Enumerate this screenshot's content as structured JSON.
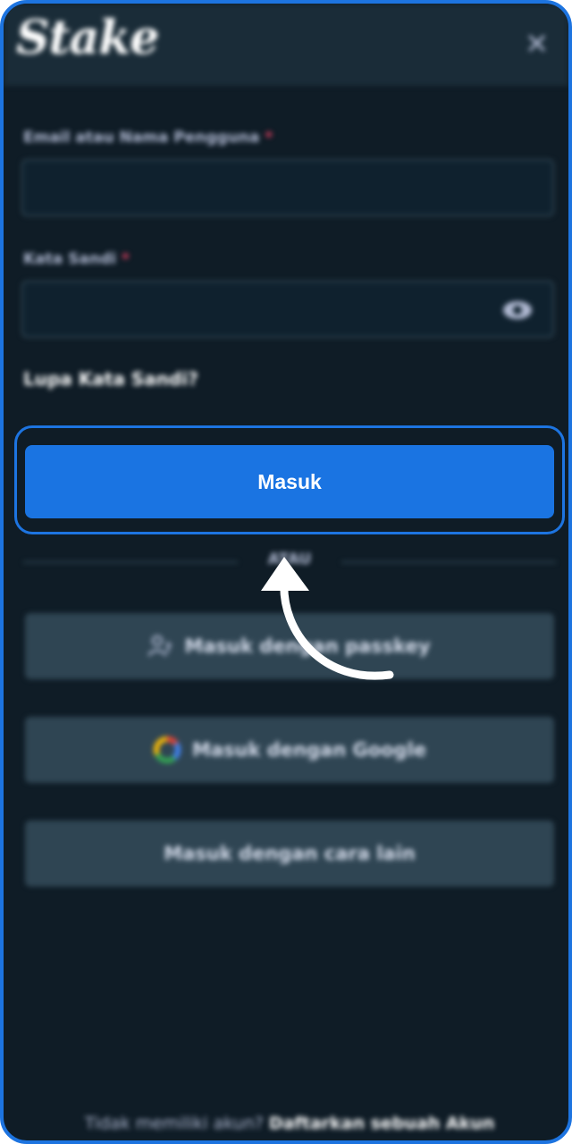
{
  "app": {
    "logo_text": "Stake"
  },
  "form": {
    "email_label": "Email atau Nama Pengguna",
    "password_label": "Kata Sandi",
    "required_mark": "*",
    "forgot_password": "Lupa Kata Sandi?",
    "submit_label": "Masuk",
    "divider_label": "ATAU"
  },
  "alt_logins": [
    {
      "label": "Masuk dengan passkey",
      "icon": "passkey-icon"
    },
    {
      "label": "Masuk dengan Google",
      "icon": "google-icon"
    },
    {
      "label": "Masuk dengan cara lain",
      "icon": ""
    }
  ],
  "footer": {
    "prompt": "Tidak memiliki akun?",
    "register_link": "Daftarkan sebuah Akun"
  },
  "colors": {
    "accent": "#1a74e2",
    "background": "#0f1c26",
    "required": "#ed4163"
  }
}
